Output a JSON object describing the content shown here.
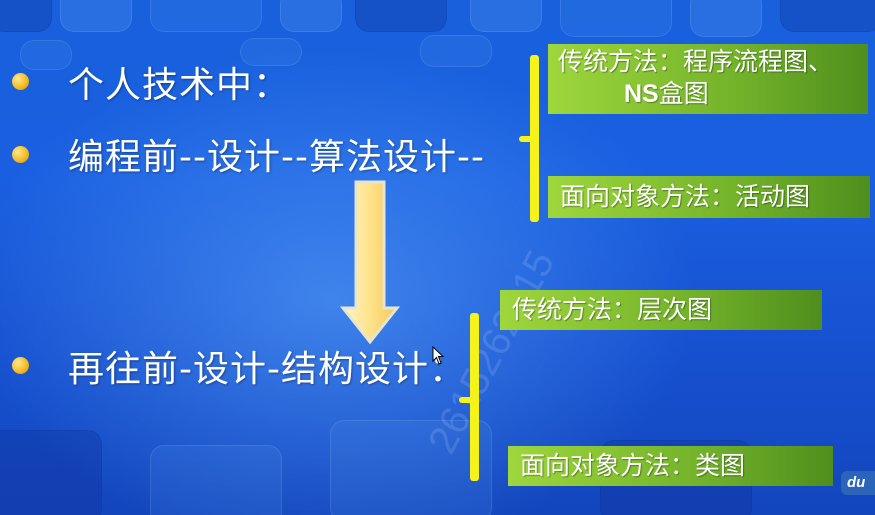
{
  "bullets": {
    "item1": "个人技术中：",
    "item2": "编程前--设计--算法设计--",
    "item3": "再往前-设计-结构设计："
  },
  "algorithm_boxes": {
    "traditional_line1": "传统方法：程序流程图、",
    "traditional_ns": "NS",
    "traditional_line2_rest": "盒图",
    "oo": "面向对象方法：活动图"
  },
  "structure_boxes": {
    "traditional": "传统方法：层次图",
    "oo": "面向对象方法：类图"
  },
  "watermark": "2615262615",
  "logo": "du",
  "colors": {
    "bullet": "#f2b81f",
    "bracket": "#f6f31a",
    "box_green": "#72b22a",
    "arrow": "#ffe28a"
  },
  "icons": {
    "arrow": "down-arrow-icon",
    "cursor": "mouse-cursor-icon"
  }
}
